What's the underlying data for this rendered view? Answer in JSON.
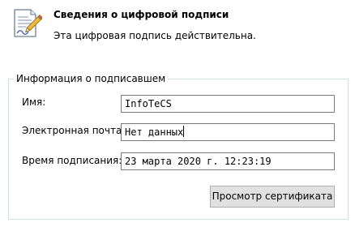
{
  "header": {
    "icon": "signed-document-icon",
    "title": "Сведения о цифровой подписи",
    "subtitle": "Эта цифровая подпись действительна."
  },
  "signer_group": {
    "legend": "Информация о подписавшем",
    "fields": [
      {
        "label": "Имя:",
        "value": "InfoTeCS"
      },
      {
        "label": "Электронная почта:",
        "value": "Нет данных"
      },
      {
        "label": "Время подписания:",
        "value": "23 марта 2020 г. 12:23:19"
      }
    ],
    "view_certificate_label": "Просмотр сертификата"
  },
  "colors": {
    "group_border": "#d5dfe5",
    "input_border": "#7a7a7a",
    "button_face": "#e1e1e1",
    "button_border": "#adadad"
  }
}
